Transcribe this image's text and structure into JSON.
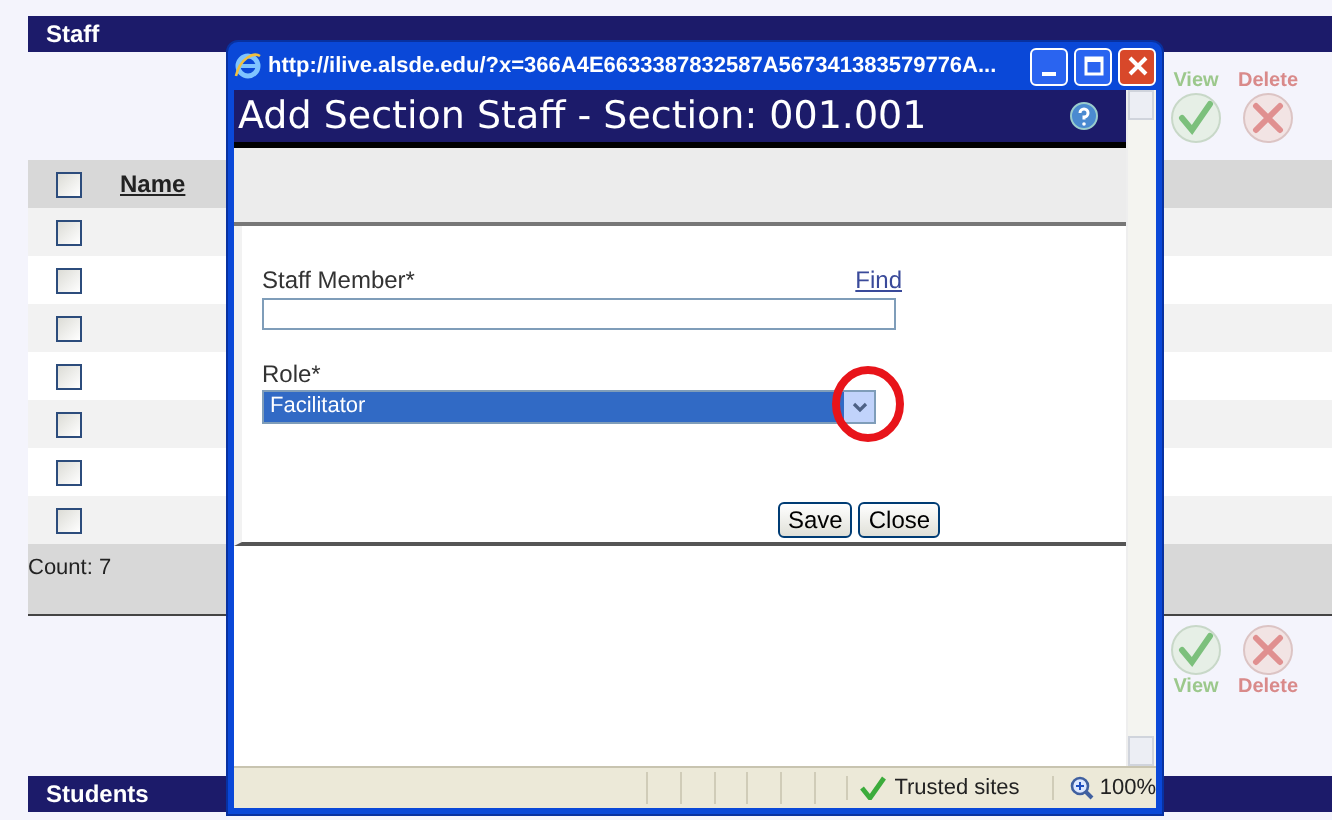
{
  "staff_section": {
    "title": "Staff",
    "top_actions": [
      {
        "kind": "view",
        "label": "View"
      },
      {
        "kind": "delete",
        "label": "Delete"
      }
    ],
    "table": {
      "select_all": {
        "checked": false
      },
      "columns": [
        "Name"
      ],
      "rows": [
        {
          "checked": false
        },
        {
          "checked": false
        },
        {
          "checked": false
        },
        {
          "checked": false
        },
        {
          "checked": false
        },
        {
          "checked": false
        },
        {
          "checked": false
        }
      ],
      "count": "Count: 7"
    },
    "bottom_actions": [
      {
        "kind": "view",
        "label": "View"
      },
      {
        "kind": "delete",
        "label": "Delete"
      }
    ]
  },
  "students_section": {
    "title": "Students"
  },
  "popup": {
    "url": "http://ilive.alsde.edu/?x=366A4E6633387832587A567341383579776A...",
    "heading": "Add Section Staff - Section: 001.001",
    "staff_member": {
      "label": "Staff Member*",
      "link": "Find"
    },
    "role": {
      "label": "Role*",
      "value": "Facilitator"
    },
    "buttons": [
      "Save",
      "Close"
    ],
    "status_bar": {
      "zone": "Trusted sites",
      "zoom": "100%"
    }
  }
}
